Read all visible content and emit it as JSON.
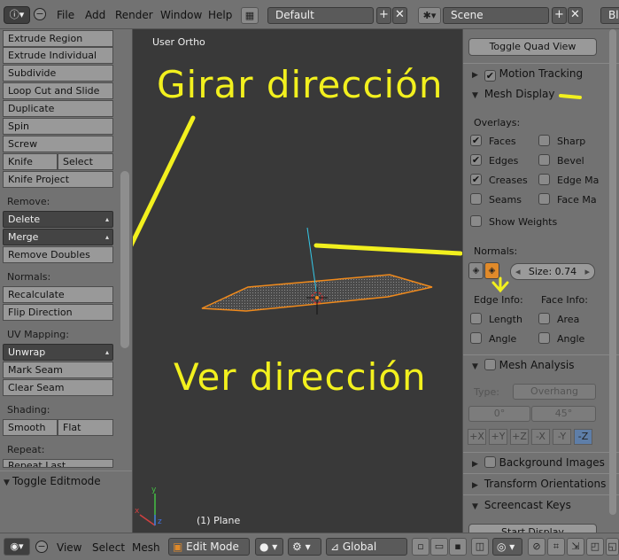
{
  "header": {
    "menus": [
      "File",
      "Add",
      "Render",
      "Window",
      "Help"
    ],
    "layout_name": "Default",
    "scene_name": "Scene",
    "engine_clip": "Ble"
  },
  "toolshelf": {
    "buttons_top": [
      "Extrude Region",
      "Extrude Individual",
      "Subdivide",
      "Loop Cut and Slide",
      "Duplicate",
      "Spin",
      "Screw"
    ],
    "knife": "Knife",
    "select": "Select",
    "knife_project": "Knife Project",
    "remove_label": "Remove:",
    "delete": "Delete",
    "merge": "Merge",
    "remove_doubles": "Remove Doubles",
    "normals_label": "Normals:",
    "recalculate": "Recalculate",
    "flip_direction": "Flip Direction",
    "uv_label": "UV Mapping:",
    "unwrap": "Unwrap",
    "mark_seam": "Mark Seam",
    "clear_seam": "Clear Seam",
    "shading_label": "Shading:",
    "smooth": "Smooth",
    "flat": "Flat",
    "repeat_label": "Repeat:",
    "repeat_last": "Repeat Last",
    "toggle_editmode": "Toggle Editmode"
  },
  "viewport": {
    "view_label": "User Ortho",
    "object_label": "(1) Plane",
    "annotation_top": "Girar dirección",
    "annotation_bottom": "Ver dirección"
  },
  "properties": {
    "toggle_quad": "Toggle Quad View",
    "motion_tracking": "Motion Tracking",
    "mesh_display": "Mesh Display",
    "overlays_label": "Overlays:",
    "overlays_left": [
      {
        "label": "Faces",
        "checked": true
      },
      {
        "label": "Edges",
        "checked": true
      },
      {
        "label": "Creases",
        "checked": true
      },
      {
        "label": "Seams",
        "checked": false
      }
    ],
    "overlays_right": [
      {
        "label": "Sharp",
        "checked": false
      },
      {
        "label": "Bevel",
        "checked": false
      },
      {
        "label": "Edge Ma",
        "checked": false
      },
      {
        "label": "Face Ma",
        "checked": false
      }
    ],
    "show_weights": "Show Weights",
    "normals_label": "Normals:",
    "size_field": "Size: 0.74",
    "edge_info_label": "Edge Info:",
    "face_info_label": "Face Info:",
    "edge_info": [
      "Length",
      "Angle"
    ],
    "face_info": [
      "Area",
      "Angle"
    ],
    "mesh_analysis": "Mesh Analysis",
    "type_label": "Type:",
    "type_value": "Overhang",
    "angle_min": "0°",
    "angle_max": "45°",
    "axes": [
      "+X",
      "+Y",
      "+Z",
      "-X",
      "-Y",
      "-Z"
    ],
    "active_axis": "-Z",
    "background_images": "Background Images",
    "transform_orientations": "Transform Orientations",
    "screencast_keys": "Screencast Keys",
    "start_display": "Start Display"
  },
  "bottombar": {
    "menus": [
      "View",
      "Select",
      "Mesh"
    ],
    "mode": "Edit Mode",
    "orientation": "Global"
  },
  "colors": {
    "annotation": "#f2f01e",
    "mesh_edge": "#f08a1c",
    "viewport_bg": "#393939",
    "panel_bg": "#727272"
  }
}
